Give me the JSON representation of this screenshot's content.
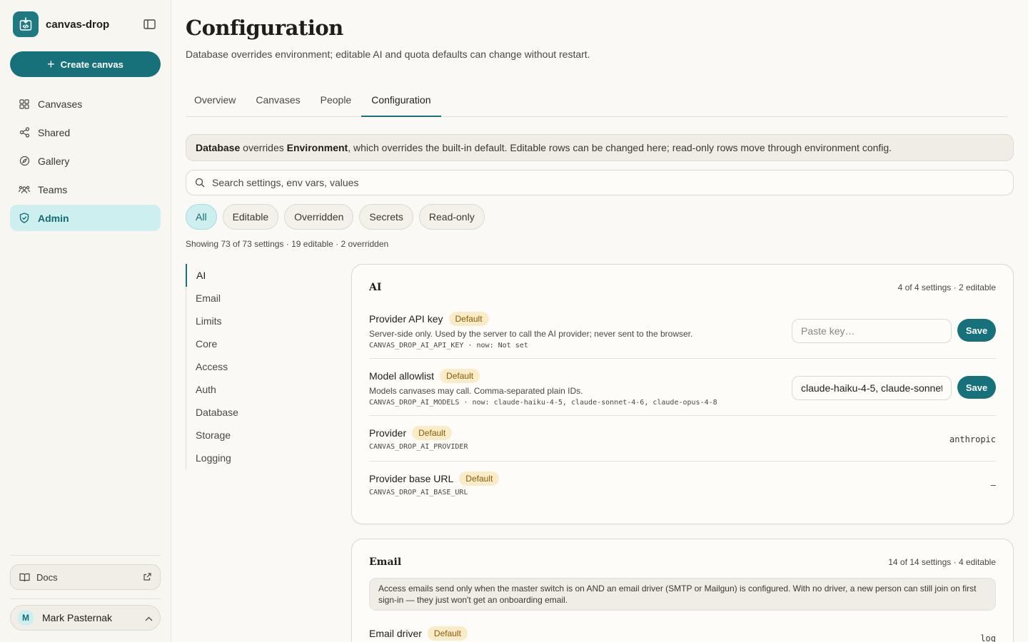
{
  "app": {
    "name": "canvas-drop"
  },
  "sidebar": {
    "create_label": "Create canvas",
    "items": [
      {
        "label": "Canvases",
        "icon": "grid-icon"
      },
      {
        "label": "Shared",
        "icon": "share-icon"
      },
      {
        "label": "Gallery",
        "icon": "compass-icon"
      },
      {
        "label": "Teams",
        "icon": "users-icon"
      },
      {
        "label": "Admin",
        "icon": "shield-check-icon",
        "active": true
      }
    ],
    "docs_label": "Docs",
    "user": {
      "initial": "M",
      "name": "Mark Pasternak"
    }
  },
  "page": {
    "title": "Configuration",
    "subtitle": "Database overrides environment; editable AI and quota defaults can change without restart."
  },
  "tabs": [
    "Overview",
    "Canvases",
    "People",
    "Configuration"
  ],
  "banner": {
    "b1": "Database",
    "t1": " overrides ",
    "b2": "Environment",
    "t2": ", which overrides the built-in default. Editable rows can be changed here; read-only rows move through environment config."
  },
  "search": {
    "placeholder": "Search settings, env vars, values"
  },
  "filters": [
    "All",
    "Editable",
    "Overridden",
    "Secrets",
    "Read-only"
  ],
  "count_line": "Showing 73 of 73 settings · 19 editable · 2 overridden",
  "sections": [
    "AI",
    "Email",
    "Limits",
    "Core",
    "Access",
    "Auth",
    "Database",
    "Storage",
    "Logging"
  ],
  "ai_card": {
    "title": "AI",
    "meta": "4 of 4 settings · 2 editable",
    "rows": [
      {
        "title": "Provider API key",
        "badge": "Default",
        "desc": "Server-side only. Used by the server to call the AI provider; never sent to the browser.",
        "env": "CANVAS_DROP_AI_API_KEY · now: Not set",
        "placeholder": "Paste key…",
        "save": "Save"
      },
      {
        "title": "Model allowlist",
        "badge": "Default",
        "desc": "Models canvases may call. Comma-separated plain IDs.",
        "env": "CANVAS_DROP_AI_MODELS · now: claude-haiku-4-5, claude-sonnet-4-6, claude-opus-4-8",
        "value": "claude-haiku-4-5, claude-sonnet-4-6, claude-opus-4-8",
        "save": "Save"
      },
      {
        "title": "Provider",
        "badge": "Default",
        "env": "CANVAS_DROP_AI_PROVIDER",
        "value": "anthropic"
      },
      {
        "title": "Provider base URL",
        "badge": "Default",
        "env": "CANVAS_DROP_AI_BASE_URL",
        "value": "—"
      }
    ]
  },
  "email_card": {
    "title": "Email",
    "meta": "14 of 14 settings · 4 editable",
    "note": "Access emails send only when the master switch is on AND an email driver (SMTP or Mailgun) is configured. With no driver, a new person can still join on first sign-in — they just won't get an onboarding email.",
    "rows": [
      {
        "title": "Email driver",
        "badge": "Default",
        "value": "log"
      }
    ]
  },
  "colors": {
    "accent": "#17717a",
    "accent_soft": "#cdeff0",
    "badge_bg": "#faecc8",
    "badge_text": "#8a5a06"
  }
}
